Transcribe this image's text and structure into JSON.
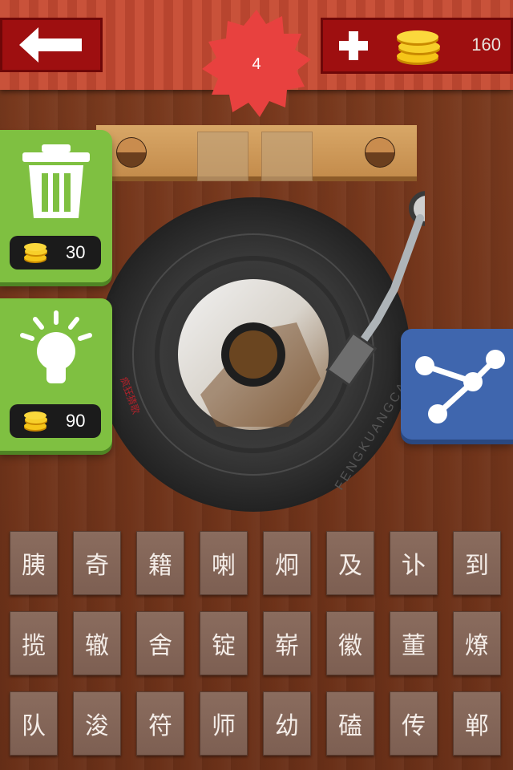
{
  "header": {
    "back_icon": "arrow-left-icon",
    "add_icon": "plus-icon",
    "coin_icon": "coin-stack-icon",
    "coins": "160",
    "level": "4"
  },
  "answer": {
    "slots": [
      "",
      ""
    ]
  },
  "tools": {
    "delete": {
      "icon": "trash-icon",
      "cost": "30"
    },
    "hint": {
      "icon": "lightbulb-icon",
      "cost": "90"
    }
  },
  "record": {
    "label_text": "FENGKUANGCAIGE",
    "side_text": "疯狂猜歌"
  },
  "share": {
    "icon": "share-icon"
  },
  "letters": [
    [
      "胰",
      "奇",
      "籍",
      "喇",
      "炯",
      "及",
      "讣",
      "到"
    ],
    [
      "揽",
      "辙",
      "舍",
      "锭",
      "崭",
      "徽",
      "董",
      "燎"
    ],
    [
      "队",
      "浚",
      "符",
      "师",
      "幼",
      "磕",
      "传",
      "郸"
    ]
  ],
  "colors": {
    "brand_red": "#9e0f10",
    "badge_red": "#e8413f",
    "tool_green": "#7fc041",
    "share_blue": "#3f66ae"
  }
}
